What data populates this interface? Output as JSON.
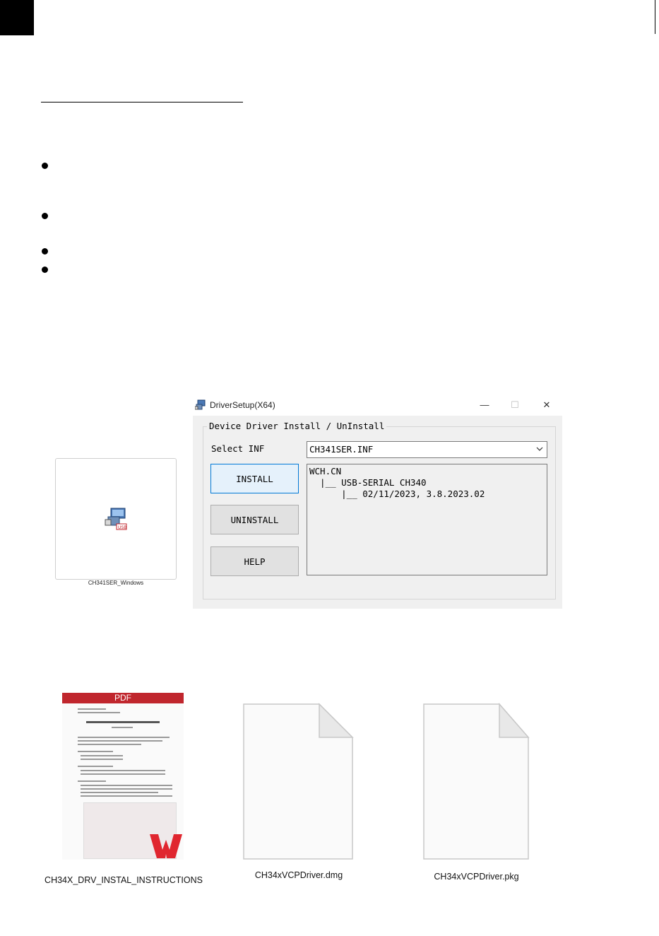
{
  "window": {
    "title": "DriverSetup(X64)",
    "controls": {
      "minimize": "—",
      "maximize": "☐",
      "close": "✕"
    },
    "group_title": "Device Driver Install / UnInstall",
    "select_label": "Select INF",
    "select_value": "CH341SER.INF",
    "buttons": {
      "install": "INSTALL",
      "uninstall": "UNINSTALL",
      "help": "HELP"
    },
    "info_lines": [
      "WCH.CN",
      "  |__ USB-SERIAL CH340",
      "      |__ 02/11/2023, 3.8.2023.02"
    ]
  },
  "files": {
    "windows_caption": "CH341SER_Windows",
    "pdf_caption": "CH34X_DRV_INSTAL_INSTRUCTIONS",
    "pdf_banner": "PDF",
    "dmg_caption": "CH34xVCPDriver.dmg",
    "pkg_caption": "CH34xVCPDriver.pkg"
  },
  "colors": {
    "focus_button_bg": "#e5f1fb",
    "focus_button_border": "#0078d7",
    "pdf_banner": "#c0262d",
    "wps_logo": "#e0262f"
  }
}
